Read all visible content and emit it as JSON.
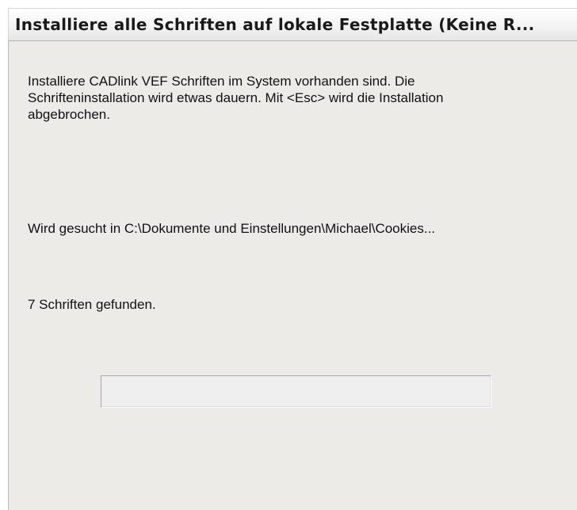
{
  "window": {
    "title": "Installiere alle Schriften auf lokale Festplatte (Keine R..."
  },
  "dialog": {
    "description": "Installiere CADlink VEF Schriften im System vorhanden sind.  Die\nSchrifteninstallation wird etwas dauern. Mit <Esc> wird die Installation\nabgebrochen.",
    "searching_text": "Wird gesucht in C:\\Dokumente und Einstellungen\\Michael\\Cookies...",
    "found_text": "7 Schriften gefunden.",
    "progress": 0
  }
}
